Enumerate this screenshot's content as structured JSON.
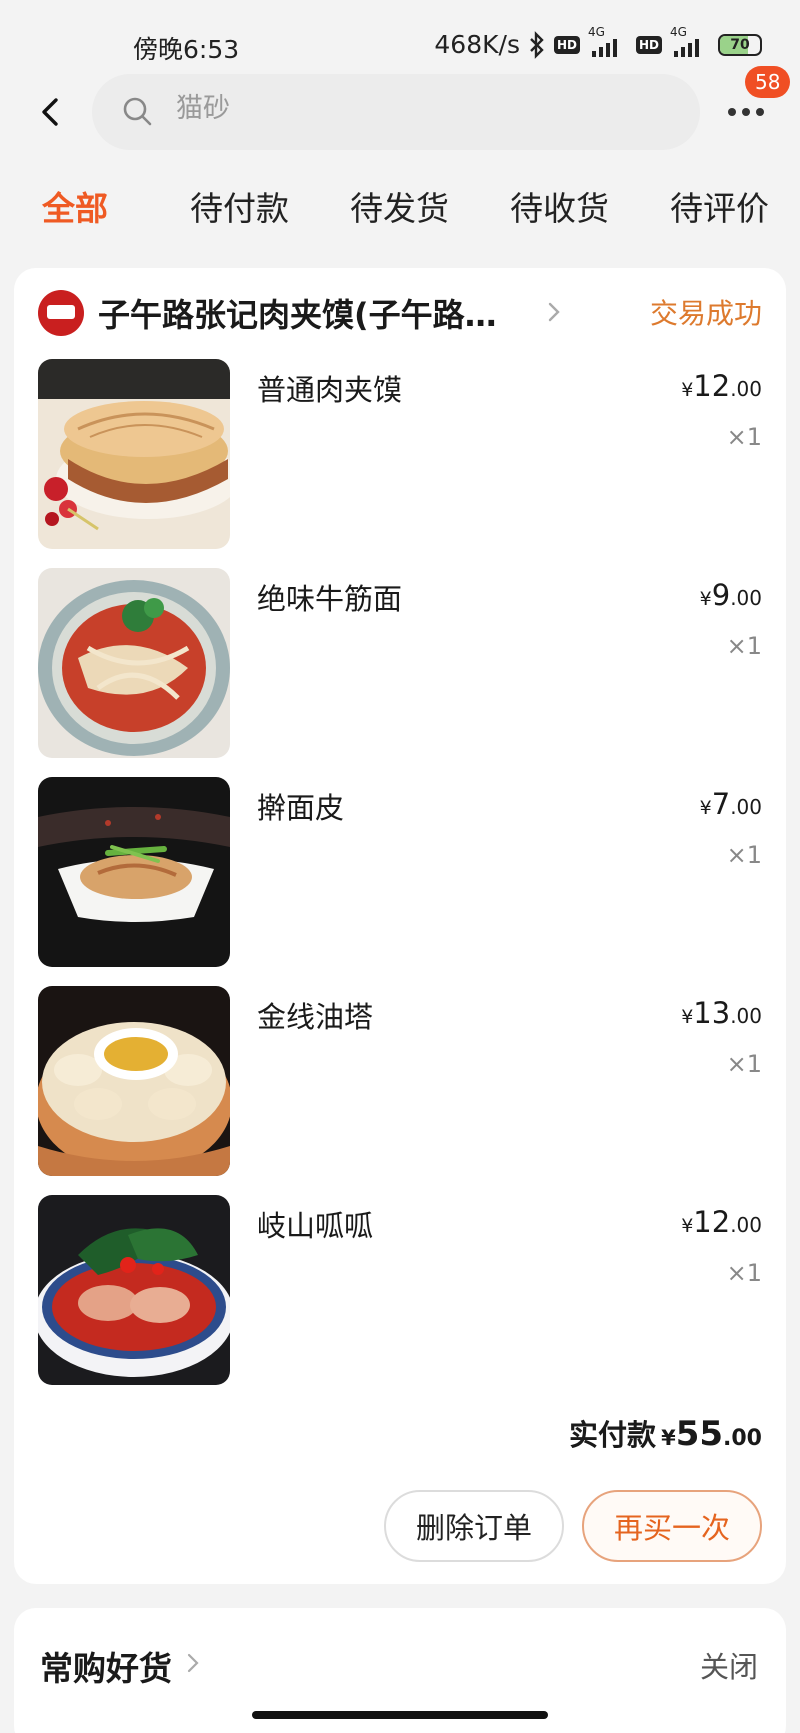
{
  "status_bar": {
    "time": "傍晚6:53",
    "net_speed": "468K/s",
    "hd": "HD",
    "network": "4G",
    "battery": "70",
    "battery_level": 0.7
  },
  "header": {
    "search_placeholder": "猫砂",
    "notification_count": "58"
  },
  "tabs": [
    {
      "label": "全部",
      "active": true
    },
    {
      "label": "待付款"
    },
    {
      "label": "待发货"
    },
    {
      "label": "待收货"
    },
    {
      "label": "待评价"
    }
  ],
  "order": {
    "shop_name": "子午路张记肉夹馍(子午路…",
    "status": "交易成功",
    "items": [
      {
        "name": "普通肉夹馍",
        "currency": "¥",
        "price_int": "12",
        "price_dec": ".00",
        "qty": "×1"
      },
      {
        "name": "绝味牛筋面",
        "currency": "¥",
        "price_int": "9",
        "price_dec": ".00",
        "qty": "×1"
      },
      {
        "name": "擀面皮",
        "currency": "¥",
        "price_int": "7",
        "price_dec": ".00",
        "qty": "×1"
      },
      {
        "name": "金线油塔",
        "currency": "¥",
        "price_int": "13",
        "price_dec": ".00",
        "qty": "×1"
      },
      {
        "name": "岐山呱呱",
        "currency": "¥",
        "price_int": "12",
        "price_dec": ".00",
        "qty": "×1"
      }
    ],
    "total_label": "实付款",
    "total_currency": "¥",
    "total_int": "55",
    "total_dec": ".00",
    "delete_label": "删除订单",
    "rebuy_label": "再买一次"
  },
  "favorites": {
    "title": "常购好货",
    "close_label": "关闭"
  },
  "colors": {
    "accent": "#ef5a23",
    "status": "#dd7a2e"
  }
}
